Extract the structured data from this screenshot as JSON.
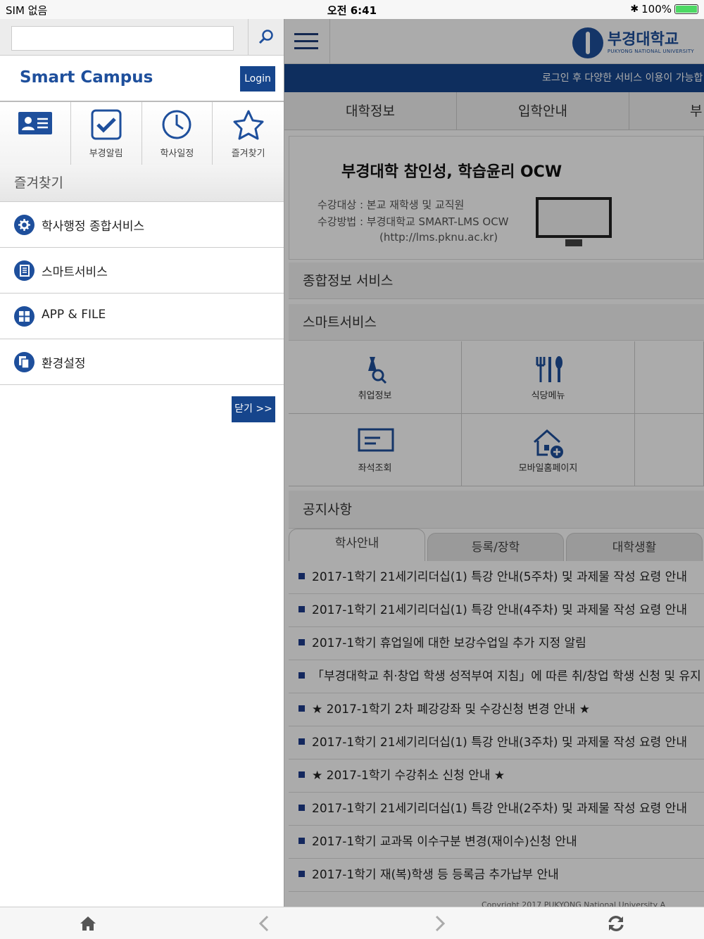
{
  "status_bar": {
    "carrier": "SIM 없음",
    "time": "오전 6:41",
    "battery": "100%",
    "battery_level": 1.0
  },
  "side_menu": {
    "search": {
      "value": "",
      "placeholder": ""
    },
    "brand": "Smart Campus",
    "login_label": "Login",
    "quick_items": [
      {
        "label": "",
        "icon": "id-card-icon"
      },
      {
        "label": "부경알림",
        "icon": "checkbox-icon"
      },
      {
        "label": "학사일정",
        "icon": "clock-icon"
      },
      {
        "label": "즐겨찾기",
        "icon": "star-icon"
      }
    ],
    "favorites_header": "즐겨찾기",
    "items": [
      {
        "label": "학사행정 종합서비스",
        "icon": "gear-icon"
      },
      {
        "label": "스마트서비스",
        "icon": "document-icon"
      },
      {
        "label": "APP & FILE",
        "icon": "grid-icon"
      },
      {
        "label": "환경설정",
        "icon": "files-icon"
      }
    ],
    "close_label": "닫기 >>"
  },
  "web_page": {
    "logo": {
      "korean": "부경대학교",
      "english": "PUKYONG NATIONAL UNIVERSITY"
    },
    "notice_marquee": "로그인 후 다양한 서비스 이용이 가능합",
    "nav_tabs": [
      "대학정보",
      "입학안내",
      "부"
    ],
    "banner": {
      "title": "부경대학 참인성, 학습윤리 OCW",
      "line1": "수강대상 : 본교 재학생 및 교직원",
      "line2": "수강방법 : 부경대학교 SMART-LMS OCW",
      "line3": "(http://lms.pknu.ac.kr)"
    },
    "section_info": "종합정보 서비스",
    "section_smart": "스마트서비스",
    "services": [
      {
        "label": "취업정보",
        "icon": "job-search-icon"
      },
      {
        "label": "식당메뉴",
        "icon": "cutlery-icon"
      },
      {
        "label": "좌석조회",
        "icon": "seat-card-icon"
      },
      {
        "label": "모바일홈페이지",
        "icon": "home-plus-icon"
      }
    ],
    "section_notice": "공지사항",
    "notice_tabs": [
      "학사안내",
      "등록/장학",
      "대학생활"
    ],
    "notices": [
      "2017-1학기 21세기리더십(1) 특강 안내(5주차) 및 과제물 작성 요령 안내",
      "2017-1학기 21세기리더십(1) 특강 안내(4주차) 및 과제물 작성 요령 안내",
      "2017-1학기 휴업일에 대한 보강수업일 추가 지정 알림",
      "「부경대학교 취·창업 학생 성적부여 지침」에 따른 취/창업 학생 신청 및 유지 등록",
      "★ 2017-1학기 2차 폐강강좌 및 수강신청 변경 안내 ★",
      "2017-1학기 21세기리더십(1) 특강 안내(3주차) 및 과제물 작성 요령 안내",
      "★ 2017-1학기 수강취소 신청 안내 ★",
      "2017-1학기 21세기리더십(1) 특강 안내(2주차) 및 과제물 작성 요령 안내",
      "2017-1학기 교과목 이수구분 변경(재이수)신청 안내",
      "2017-1학기 재(복)학생 등 등록금 추가납부 안내"
    ],
    "copyright": "Copyright 2017 PUKYONG National University A"
  },
  "toolbar": {
    "home": "home-icon",
    "back": "chevron-left-icon",
    "forward": "chevron-right-icon",
    "refresh": "refresh-icon"
  },
  "colors": {
    "primary": "#16458c",
    "accent": "#1e4f9c"
  }
}
